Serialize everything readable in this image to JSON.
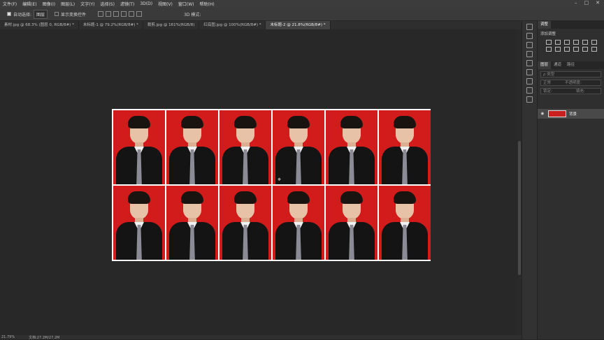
{
  "menu": [
    "文件(F)",
    "编辑(E)",
    "图像(I)",
    "图层(L)",
    "文字(Y)",
    "选择(S)",
    "滤镜(T)",
    "3D(D)",
    "视图(V)",
    "窗口(W)",
    "帮助(H)"
  ],
  "options": {
    "auto_select_label": "自动选择:",
    "layer_value": "图层",
    "show_transform_label": "显示变换控件",
    "mode_3d": "3D 模式:"
  },
  "tabs": [
    {
      "label": "素材.jpg @ 68.3% (图层 0, RGB/8#) *"
    },
    {
      "label": "未标题-1 @ 79.2%(RGB/8#) *"
    },
    {
      "label": "裁剪.jpg @ 161%(RGB/8)"
    },
    {
      "label": "红底图.jpg @ 100%(RGB/8#) *"
    },
    {
      "label": "未标题-2 @ 21.8%(RGB/8#) *"
    }
  ],
  "status": {
    "zoom": "21.79%",
    "doc": "文档:27.2M/27.2M"
  },
  "panels": {
    "tabs": [
      "调整"
    ],
    "add_adjustment": "添加调整",
    "layer_tabs": [
      "图层",
      "通道",
      "路径"
    ],
    "kind_placeholder": "ρ 类型",
    "blend_mode": "正常",
    "opacity": "不透明度:",
    "lock_label": "锁定:",
    "fill_label": "填充:",
    "layer_name": "背景"
  },
  "colors": {
    "photo_bg": "#d21c1c",
    "canvas": "#282828"
  }
}
